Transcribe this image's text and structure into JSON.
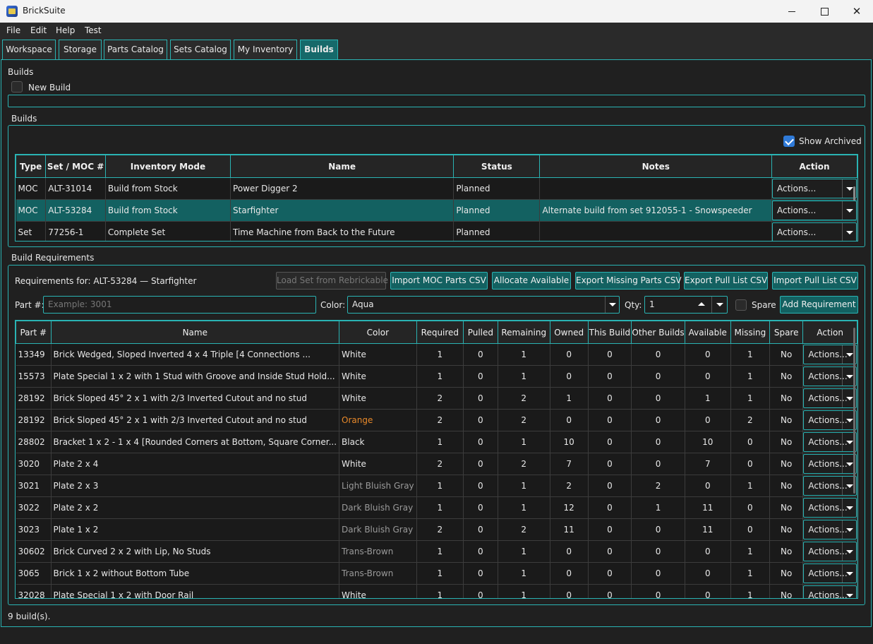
{
  "window": {
    "title": "BrickSuite"
  },
  "menu": [
    "File",
    "Edit",
    "Help",
    "Test"
  ],
  "tabs": [
    "Workspace",
    "Storage",
    "Parts Catalog",
    "Sets Catalog",
    "My Inventory",
    "Builds"
  ],
  "builds_header": {
    "title": "Builds",
    "new_build_label": "New Build"
  },
  "builds_group": {
    "title": "Builds",
    "show_archived_label": "Show Archived",
    "columns": [
      "Type",
      "Set / MOC #",
      "Inventory Mode",
      "Name",
      "Status",
      "Notes",
      "Action"
    ],
    "rows": [
      {
        "type": "MOC",
        "set": "ALT-31014",
        "mode": "Build from Stock",
        "name": "Power Digger 2",
        "status": "Planned",
        "notes": "",
        "action": "Actions..."
      },
      {
        "type": "MOC",
        "set": "ALT-53284",
        "mode": "Build from Stock",
        "name": "Starfighter",
        "status": "Planned",
        "notes": "Alternate build from set 912055-1 - Snowspeeder",
        "action": "Actions..."
      },
      {
        "type": "Set",
        "set": "77256-1",
        "mode": "Complete Set",
        "name": "Time Machine from Back to the Future",
        "status": "Planned",
        "notes": "",
        "action": "Actions..."
      }
    ]
  },
  "requirements": {
    "title": "Build Requirements",
    "for_label": "Requirements for: ALT-53284 — Starfighter",
    "buttons": {
      "load_set": "Load Set from Rebrickable",
      "import_moc": "Import MOC Parts CSV",
      "allocate": "Allocate Available",
      "export_missing": "Export Missing Parts CSV",
      "export_pull": "Export Pull List CSV",
      "import_pull": "Import Pull List CSV",
      "add_req": "Add Requirement"
    },
    "part_label": "Part #:",
    "part_placeholder": "Example: 3001",
    "color_label": "Color:",
    "color_value": "Aqua",
    "qty_label": "Qty:",
    "qty_value": "1",
    "spare_label": "Spare",
    "columns": [
      "Part #",
      "Name",
      "Color",
      "Required",
      "Pulled",
      "Remaining",
      "Owned",
      "This Build",
      "Other Builds",
      "Available",
      "Missing",
      "Spare",
      "Action"
    ],
    "rows": [
      {
        "part": "13349",
        "name": "Brick Wedged, Sloped Inverted 4 x 4 Triple [4 Connections ...",
        "color": "White",
        "color_style": "normal",
        "required": "1",
        "pulled": "0",
        "remaining": "1",
        "owned": "0",
        "this_build": "0",
        "other": "0",
        "available": "0",
        "missing": "1",
        "spare": "No",
        "action": "Actions..."
      },
      {
        "part": "15573",
        "name": "Plate Special 1 x 2 with 1 Stud with Groove and Inside Stud Hold...",
        "color": "White",
        "color_style": "normal",
        "required": "1",
        "pulled": "0",
        "remaining": "1",
        "owned": "0",
        "this_build": "0",
        "other": "0",
        "available": "0",
        "missing": "1",
        "spare": "No",
        "action": "Actions..."
      },
      {
        "part": "28192",
        "name": "Brick Sloped 45° 2 x 1 with 2/3 Inverted Cutout and no stud",
        "color": "White",
        "color_style": "normal",
        "required": "2",
        "pulled": "0",
        "remaining": "2",
        "owned": "1",
        "this_build": "0",
        "other": "0",
        "available": "1",
        "missing": "1",
        "spare": "No",
        "action": "Actions..."
      },
      {
        "part": "28192",
        "name": "Brick Sloped 45° 2 x 1 with 2/3 Inverted Cutout and no stud",
        "color": "Orange",
        "color_style": "orange",
        "required": "2",
        "pulled": "0",
        "remaining": "2",
        "owned": "0",
        "this_build": "0",
        "other": "0",
        "available": "0",
        "missing": "2",
        "spare": "No",
        "action": "Actions..."
      },
      {
        "part": "28802",
        "name": "Bracket 1 x 2 - 1 x 4 [Rounded Corners at Bottom, Square Corner...",
        "color": "Black",
        "color_style": "normal",
        "required": "1",
        "pulled": "0",
        "remaining": "1",
        "owned": "10",
        "this_build": "0",
        "other": "0",
        "available": "10",
        "missing": "0",
        "spare": "No",
        "action": "Actions..."
      },
      {
        "part": "3020",
        "name": "Plate 2 x 4",
        "color": "White",
        "color_style": "normal",
        "required": "2",
        "pulled": "0",
        "remaining": "2",
        "owned": "7",
        "this_build": "0",
        "other": "0",
        "available": "7",
        "missing": "0",
        "spare": "No",
        "action": "Actions..."
      },
      {
        "part": "3021",
        "name": "Plate 2 x 3",
        "color": "Light Bluish Gray",
        "color_style": "muted",
        "required": "1",
        "pulled": "0",
        "remaining": "1",
        "owned": "2",
        "this_build": "0",
        "other": "2",
        "available": "0",
        "missing": "1",
        "spare": "No",
        "action": "Actions..."
      },
      {
        "part": "3022",
        "name": "Plate 2 x 2",
        "color": "Dark Bluish Gray",
        "color_style": "muted",
        "required": "1",
        "pulled": "0",
        "remaining": "1",
        "owned": "12",
        "this_build": "0",
        "other": "1",
        "available": "11",
        "missing": "0",
        "spare": "No",
        "action": "Actions..."
      },
      {
        "part": "3023",
        "name": "Plate 1 x 2",
        "color": "Dark Bluish Gray",
        "color_style": "muted",
        "required": "2",
        "pulled": "0",
        "remaining": "2",
        "owned": "11",
        "this_build": "0",
        "other": "0",
        "available": "11",
        "missing": "0",
        "spare": "No",
        "action": "Actions..."
      },
      {
        "part": "30602",
        "name": "Brick Curved 2 x 2 with Lip, No Studs",
        "color": "Trans-Brown",
        "color_style": "muted",
        "required": "1",
        "pulled": "0",
        "remaining": "1",
        "owned": "0",
        "this_build": "0",
        "other": "0",
        "available": "0",
        "missing": "1",
        "spare": "No",
        "action": "Actions..."
      },
      {
        "part": "3065",
        "name": "Brick 1 x 2 without Bottom Tube",
        "color": "Trans-Brown",
        "color_style": "muted",
        "required": "1",
        "pulled": "0",
        "remaining": "1",
        "owned": "0",
        "this_build": "0",
        "other": "0",
        "available": "0",
        "missing": "1",
        "spare": "No",
        "action": "Actions..."
      },
      {
        "part": "32028",
        "name": "Plate Special 1 x 2 with Door Rail",
        "color": "White",
        "color_style": "normal",
        "required": "1",
        "pulled": "0",
        "remaining": "1",
        "owned": "0",
        "this_build": "0",
        "other": "0",
        "available": "0",
        "missing": "1",
        "spare": "No",
        "action": "Actions..."
      }
    ]
  },
  "status": {
    "text": "9 build(s)."
  },
  "colors": {
    "accent": "#2ab3b3",
    "selected": "#136161",
    "orange": "#e8892a"
  }
}
